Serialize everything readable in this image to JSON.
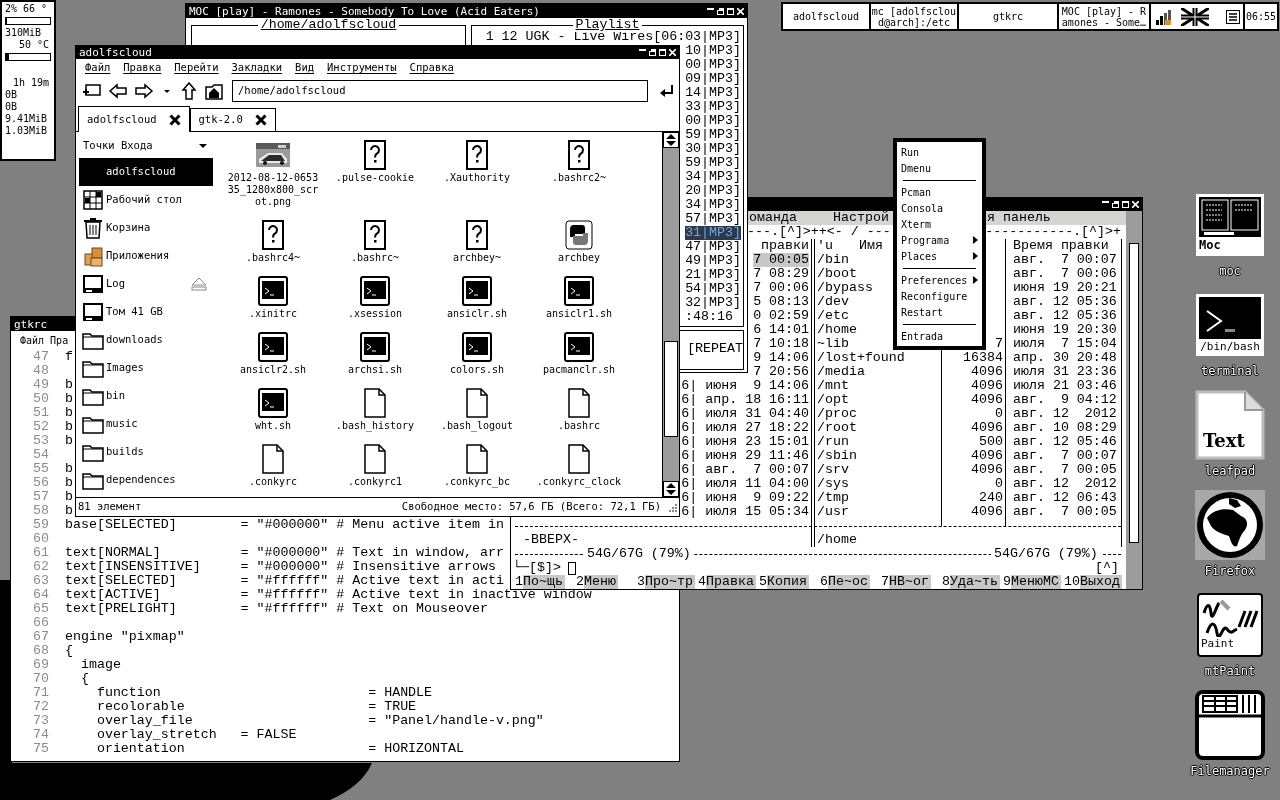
{
  "conky": {
    "items": [
      {
        "kind": "text",
        "text": "2% 66 °"
      },
      {
        "kind": "bar",
        "level": 0.02
      },
      {
        "kind": "text",
        "text": "310MiB"
      },
      {
        "kind": "text_right",
        "text": "50 °C"
      },
      {
        "kind": "bar",
        "level": 0.07
      },
      {
        "kind": "text_right",
        "text": "1h 19m"
      },
      {
        "kind": "text",
        "text": "0B"
      },
      {
        "kind": "text",
        "text": "0B"
      },
      {
        "kind": "text",
        "text": "9.41MiB"
      },
      {
        "kind": "text",
        "text": "1.03MiB"
      }
    ]
  },
  "gtkrc": {
    "title": "gtkrc",
    "menu": [
      "Файл",
      "Пра"
    ],
    "lines": [
      {
        "number": "47",
        "code": "f"
      },
      {
        "number": "48"
      },
      {
        "number": "49",
        "code": "b"
      },
      {
        "number": "50",
        "code": "b"
      },
      {
        "number": "51",
        "code": "b"
      },
      {
        "number": "52",
        "code": "b"
      },
      {
        "number": "53",
        "code": "b"
      },
      {
        "number": "54"
      },
      {
        "number": "55",
        "code": "b"
      },
      {
        "number": "56",
        "code": "b"
      },
      {
        "number": "57",
        "code": "b"
      },
      {
        "number": "58",
        "code": "b"
      },
      {
        "number": "59",
        "code": "base[SELECTED]        = \"#000000\" # Menu active item in"
      },
      {
        "number": "60"
      },
      {
        "number": "61",
        "code": "text[NORMAL]          = \"#000000\" # Text in window, arr"
      },
      {
        "number": "62",
        "code": "text[INSENSITIVE]     = \"#000000\" # Insensitive arrows"
      },
      {
        "number": "63",
        "code": "text[SELECTED]        = \"#ffffff\" # Active text in acti"
      },
      {
        "number": "64",
        "code": "text[ACTIVE]          = \"#ffffff\" # Active text in inactive window"
      },
      {
        "number": "65",
        "code": "text[PRELIGHT]        = \"#ffffff\" # Text on Mouseover"
      },
      {
        "number": "66"
      },
      {
        "number": "67",
        "code": "engine \"pixmap\""
      },
      {
        "number": "68",
        "code": "{"
      },
      {
        "number": "69",
        "code": "  image"
      },
      {
        "number": "70",
        "code": "  {"
      },
      {
        "number": "71",
        "code": "    function                          = HANDLE"
      },
      {
        "number": "72",
        "code": "    recolorable                       = TRUE"
      },
      {
        "number": "73",
        "code": "    overlay_file                      = \"Panel/handle-v.png\""
      },
      {
        "number": "74",
        "code": "    overlay_stretch   = FALSE"
      },
      {
        "number": "75",
        "code": "    orientation                       = HORIZONTAL"
      }
    ]
  },
  "mc": {
    "menu_fragments": [
      "оманда",
      "Настрой",
      "я панель"
    ],
    "frame_fragments": [
      "---.[^]>++<- / ---",
      "-----------.[^]>+"
    ],
    "headers": {
      "left_tail": "правки",
      "attr": "'u",
      "name": "Имя",
      "date": "Время правки"
    },
    "rows": [
      {
        "left": "7 00:05",
        "selected": true,
        "name": "/bin",
        "date": "авг.  7 00:07"
      },
      {
        "left": "7 08:29",
        "selected": false,
        "name": "/boot",
        "date": "авг.  7 00:06"
      },
      {
        "left": "7 00:06",
        "selected": false,
        "name": "/bypass",
        "date": "июня 19 20:21"
      },
      {
        "left": "5 08:13",
        "selected": false,
        "name": "/dev",
        "date": "авг. 12 05:36"
      },
      {
        "left": "0 02:59",
        "selected": false,
        "name": "/etc",
        "date": "авг. 12 05:36"
      },
      {
        "left": "6 14:01",
        "selected": false,
        "name": "/home",
        "date": "июня 19 20:30"
      },
      {
        "left": "7 10:18",
        "selected": false,
        "name": "~lib",
        "size": "7",
        "date": "июля  7 15:04"
      },
      {
        "left": "9 14:06",
        "selected": false,
        "name": "/lost+found",
        "size": "16384",
        "date": "апр. 30 20:48"
      },
      {
        "left": "7 20:56",
        "selected": false,
        "name": "/media",
        "size": "4096",
        "date": "июля 31 23:36"
      },
      {
        "left": "6| июня  9 14:06",
        "selected": false,
        "name": "/mnt",
        "size": "4096",
        "date": "июля 21 03:46"
      },
      {
        "left": "6| апр. 18 16:11",
        "selected": false,
        "name": "/opt",
        "size": "4096",
        "date": "авг.  9 04:12"
      },
      {
        "left": "6| июля 31 04:40",
        "selected": false,
        "name": "/proc",
        "size": "0",
        "date": "авг. 12  2012"
      },
      {
        "left": "6| июля 27 18:22",
        "selected": false,
        "name": "/root",
        "size": "4096",
        "date": "авг. 10 08:29"
      },
      {
        "left": "6| июня 23 15:01",
        "selected": false,
        "name": "/run",
        "size": "500",
        "date": "авг. 12 05:46"
      },
      {
        "left": "6| июня 29 11:46",
        "selected": false,
        "name": "/sbin",
        "size": "4096",
        "date": "авг.  7 00:07"
      },
      {
        "left": "6| авг.  7 00:07",
        "selected": false,
        "name": "/srv",
        "size": "4096",
        "date": "авг.  7 00:05"
      },
      {
        "left": "6| июля 11 04:00",
        "selected": false,
        "name": "/sys",
        "size": "0",
        "date": "авг. 12  2012"
      },
      {
        "left": "6| июня  9 09:22",
        "selected": false,
        "name": "/tmp",
        "size": "240",
        "date": "авг. 12 06:43"
      },
      {
        "left": "6| июля 15 05:34",
        "selected": false,
        "name": "/usr",
        "size": "4096",
        "date": "авг.  7 00:05"
      }
    ],
    "bottom": {
      "left_label": "-ВВЕРХ-",
      "right_path": "/home",
      "left_usage": "54G/67G (79%)",
      "right_usage": "54G/67G (79%)",
      "prompt": "└─[$]>",
      "scroll_mark": "[^]"
    },
    "fkeys": [
      {
        "num": "1",
        "label": "По~щь"
      },
      {
        "num": "2",
        "label": "Меню"
      },
      {
        "num": "3",
        "label": "Про~тр"
      },
      {
        "num": "4",
        "label": "Правка"
      },
      {
        "num": "5",
        "label": "Копия"
      },
      {
        "num": "6",
        "label": "Пе~ос"
      },
      {
        "num": "7",
        "label": "НВ~ог"
      },
      {
        "num": "8",
        "label": "Уда~ть"
      },
      {
        "num": "9",
        "label": "МенюМС"
      },
      {
        "num": "10",
        "label": "Выход"
      }
    ]
  },
  "moc": {
    "title": "MOC [play] - Ramones - Somebody To Love (Acid Eaters)",
    "left_header": "/home/adolfscloud",
    "playlist": {
      "header": "Playlist",
      "first_row": "1 12 UGK - Live Wires[06:03|MP3]",
      "rows": [
        {
          "text": "10|MP3]",
          "selected": false
        },
        {
          "text": "00|MP3]",
          "selected": false
        },
        {
          "text": "09|MP3]",
          "selected": false
        },
        {
          "text": "14|MP3]",
          "selected": false
        },
        {
          "text": "33|MP3]",
          "selected": false
        },
        {
          "text": "00|MP3]",
          "selected": false
        },
        {
          "text": "59|MP3]",
          "selected": false
        },
        {
          "text": "30|MP3]",
          "selected": false
        },
        {
          "text": "59|MP3]",
          "selected": false
        },
        {
          "text": "34|MP3]",
          "selected": false
        },
        {
          "text": "20|MP3]",
          "selected": false
        },
        {
          "text": "34|MP3]",
          "selected": false
        },
        {
          "text": "57|MP3]",
          "selected": false
        },
        {
          "text": "31|MP3]",
          "selected": true
        },
        {
          "text": "47|MP3]",
          "selected": false
        },
        {
          "text": "49|MP3]",
          "selected": false
        },
        {
          "text": "21|MP3]",
          "selected": false
        },
        {
          "text": "54|MP3]",
          "selected": false
        },
        {
          "text": "32|MP3]",
          "selected": false
        }
      ],
      "time": ":48:16",
      "mode": "[REPEAT"
    }
  },
  "file_manager": {
    "title": "adolfscloud",
    "menu": [
      "Файл",
      "Правка",
      "Перейти",
      "Закладки",
      "Вид",
      "Инструменты",
      "Справка"
    ],
    "address": "/home/adolfscloud",
    "tabs": [
      {
        "label": "adolfscloud",
        "selected": true
      },
      {
        "label": "gtk-2.0",
        "selected": false
      }
    ],
    "sidebar": {
      "header": "Точки Входа",
      "items": [
        {
          "label": "adolfscloud",
          "kind": "home",
          "selected": true,
          "eject": false
        },
        {
          "label": "Рабочий стол",
          "kind": "desktop",
          "selected": false,
          "eject": false
        },
        {
          "label": "Корзина",
          "kind": "trash",
          "selected": false,
          "eject": false
        },
        {
          "label": "Приложения",
          "kind": "apps",
          "selected": false,
          "eject": false
        },
        {
          "label": "Log",
          "kind": "drive",
          "selected": false,
          "eject": true
        },
        {
          "label": "Том 41 GB",
          "kind": "drive",
          "selected": false,
          "eject": false
        },
        {
          "label": "downloads",
          "kind": "folder",
          "selected": false,
          "eject": false
        },
        {
          "label": "Images",
          "kind": "folder",
          "selected": false,
          "eject": false
        },
        {
          "label": "bin",
          "kind": "folder",
          "selected": false,
          "eject": false
        },
        {
          "label": "music",
          "kind": "folder",
          "selected": false,
          "eject": false
        },
        {
          "label": "builds",
          "kind": "folder",
          "selected": false,
          "eject": false
        },
        {
          "label": "dependences",
          "kind": "folder",
          "selected": false,
          "eject": false
        }
      ]
    },
    "files": [
      {
        "name": "2012-08-12-065335_1280x800_scrot.png"
      },
      {
        "name": ".pulse-cookie",
        "kind": "unknown"
      },
      {
        "name": ".Xauthority",
        "kind": "unknown"
      },
      {
        "name": ".bashrc2~",
        "kind": "unknown"
      },
      {
        "name": ".bashrc4~",
        "kind": "unknown"
      },
      {
        "name": ".bashrc~",
        "kind": "unknown"
      },
      {
        "name": "archbey~",
        "kind": "unknown"
      },
      {
        "name": "archbey",
        "kind": "python"
      },
      {
        "name": ".xinitrc",
        "kind": "script"
      },
      {
        "name": ".xsession",
        "kind": "script"
      },
      {
        "name": "ansiclr.sh",
        "kind": "script"
      },
      {
        "name": "ansiclr1.sh",
        "kind": "script"
      },
      {
        "name": "ansiclr2.sh",
        "kind": "script"
      },
      {
        "name": "archsi.sh",
        "kind": "script"
      },
      {
        "name": "colors.sh",
        "kind": "script"
      },
      {
        "name": "pacmanclr.sh",
        "kind": "script"
      },
      {
        "name": "wht.sh",
        "kind": "script"
      },
      {
        "name": ".bash_history",
        "kind": "text"
      },
      {
        "name": ".bash_logout",
        "kind": "text"
      },
      {
        "name": ".bashrc",
        "kind": "text"
      },
      {
        "name": ".conkyrc",
        "kind": "text"
      },
      {
        "name": ".conkyrc1",
        "kind": "text"
      },
      {
        "name": ".conkyrc_bc",
        "kind": "text"
      },
      {
        "name": ".conkyrc_clock",
        "kind": "text"
      }
    ],
    "status": {
      "count": "81 элемент",
      "free": "Свободное место: 57,6 ГБ (Всего: 72,1 ГБ)"
    }
  },
  "taskbar": {
    "tasks": [
      {
        "label": "adolfscloud"
      },
      {
        "label": "mc [adolfscloud@arch]:/etc"
      },
      {
        "label": "gtkrc"
      },
      {
        "label": "MOC [play] - Ramones - Some…"
      }
    ],
    "clock": "06:55"
  },
  "openbox_menu": {
    "items": [
      {
        "kind": "item",
        "label": "Run"
      },
      {
        "kind": "item",
        "label": "Dmenu"
      },
      {
        "kind": "separator"
      },
      {
        "kind": "item",
        "label": "Pcman"
      },
      {
        "kind": "item",
        "label": "Consola"
      },
      {
        "kind": "item",
        "label": "Xterm"
      },
      {
        "kind": "submenu",
        "label": "Programa"
      },
      {
        "kind": "submenu",
        "label": "Places"
      },
      {
        "kind": "separator"
      },
      {
        "kind": "submenu",
        "label": "Preferences"
      },
      {
        "kind": "item",
        "label": "Reconfigure"
      },
      {
        "kind": "item",
        "label": "Restart"
      },
      {
        "kind": "separator"
      },
      {
        "kind": "item",
        "label": "Entrada"
      }
    ]
  },
  "desktop_icons": [
    {
      "kind": "moc",
      "label": "moc",
      "caption": "Moc"
    },
    {
      "kind": "terminal",
      "label": "terminal",
      "caption": "/bin/bash"
    },
    {
      "kind": "text_editor",
      "label": "leafpad",
      "caption": "Text"
    },
    {
      "kind": "browser",
      "label": "Firefox"
    },
    {
      "kind": "paint",
      "label": "mtPaint",
      "caption": "Paint"
    },
    {
      "kind": "file_manager",
      "label": "Filemanager"
    }
  ]
}
